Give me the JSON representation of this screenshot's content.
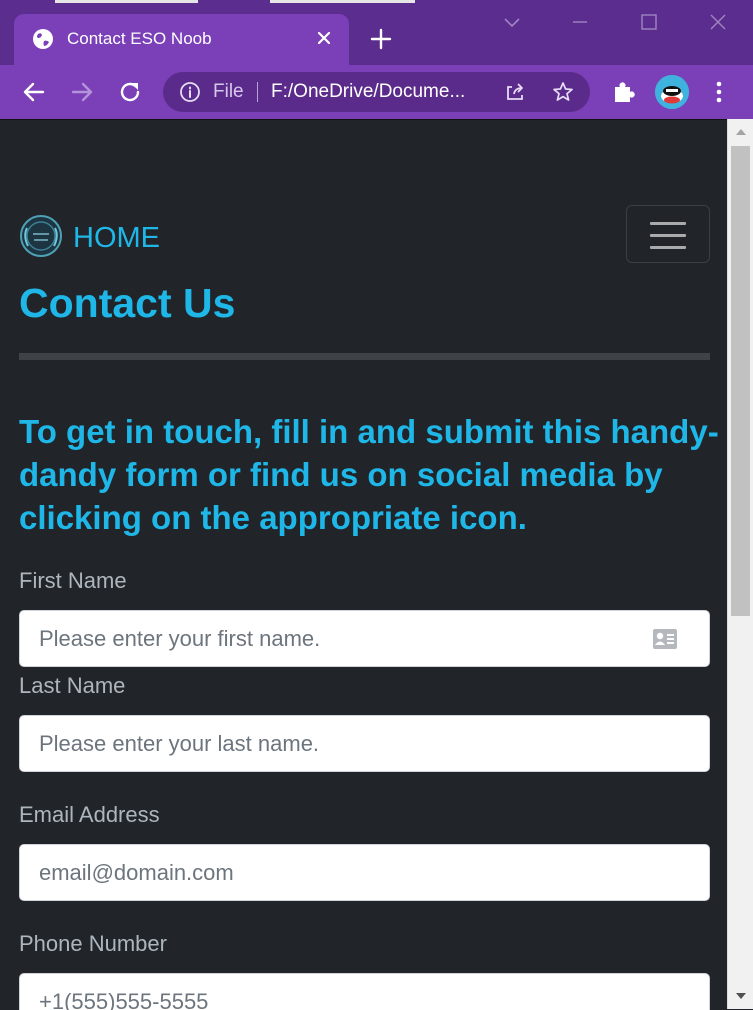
{
  "browser": {
    "tab_title": "Contact ESO Noob",
    "omnibox_scheme": "File",
    "omnibox_url": "F:/OneDrive/Documents/ESO Noob/contact.html",
    "omnibox_url_visible": "F:/OneDrive/Docume...",
    "icons": [
      "globe-icon",
      "close-icon",
      "plus-icon",
      "chevron-down-icon",
      "minimize-icon",
      "maximize-icon",
      "window-close-icon",
      "back-arrow-icon",
      "forward-arrow-icon",
      "reload-icon",
      "info-icon",
      "share-icon",
      "star-icon",
      "puzzle-icon",
      "kebab-menu-icon"
    ]
  },
  "page": {
    "brand": "HOME",
    "title": "Contact Us",
    "intro": "To get in touch, fill in and submit this handy-dandy form or find us on social media by clicking on the appropriate icon.",
    "form": {
      "first_name": {
        "label": "First Name",
        "placeholder": "Please enter your first name.",
        "value": ""
      },
      "last_name": {
        "label": "Last Name",
        "placeholder": "Please enter your last name.",
        "value": ""
      },
      "email": {
        "label": "Email Address",
        "placeholder": "email@domain.com",
        "value": ""
      },
      "phone": {
        "label": "Phone Number",
        "placeholder": "+1(555)555-5555",
        "value": ""
      }
    }
  },
  "colors": {
    "page_bg": "#212529",
    "accent": "#1fb7e8",
    "chrome": "#7b3fb8",
    "chrome_dark": "#5b2d8e"
  }
}
